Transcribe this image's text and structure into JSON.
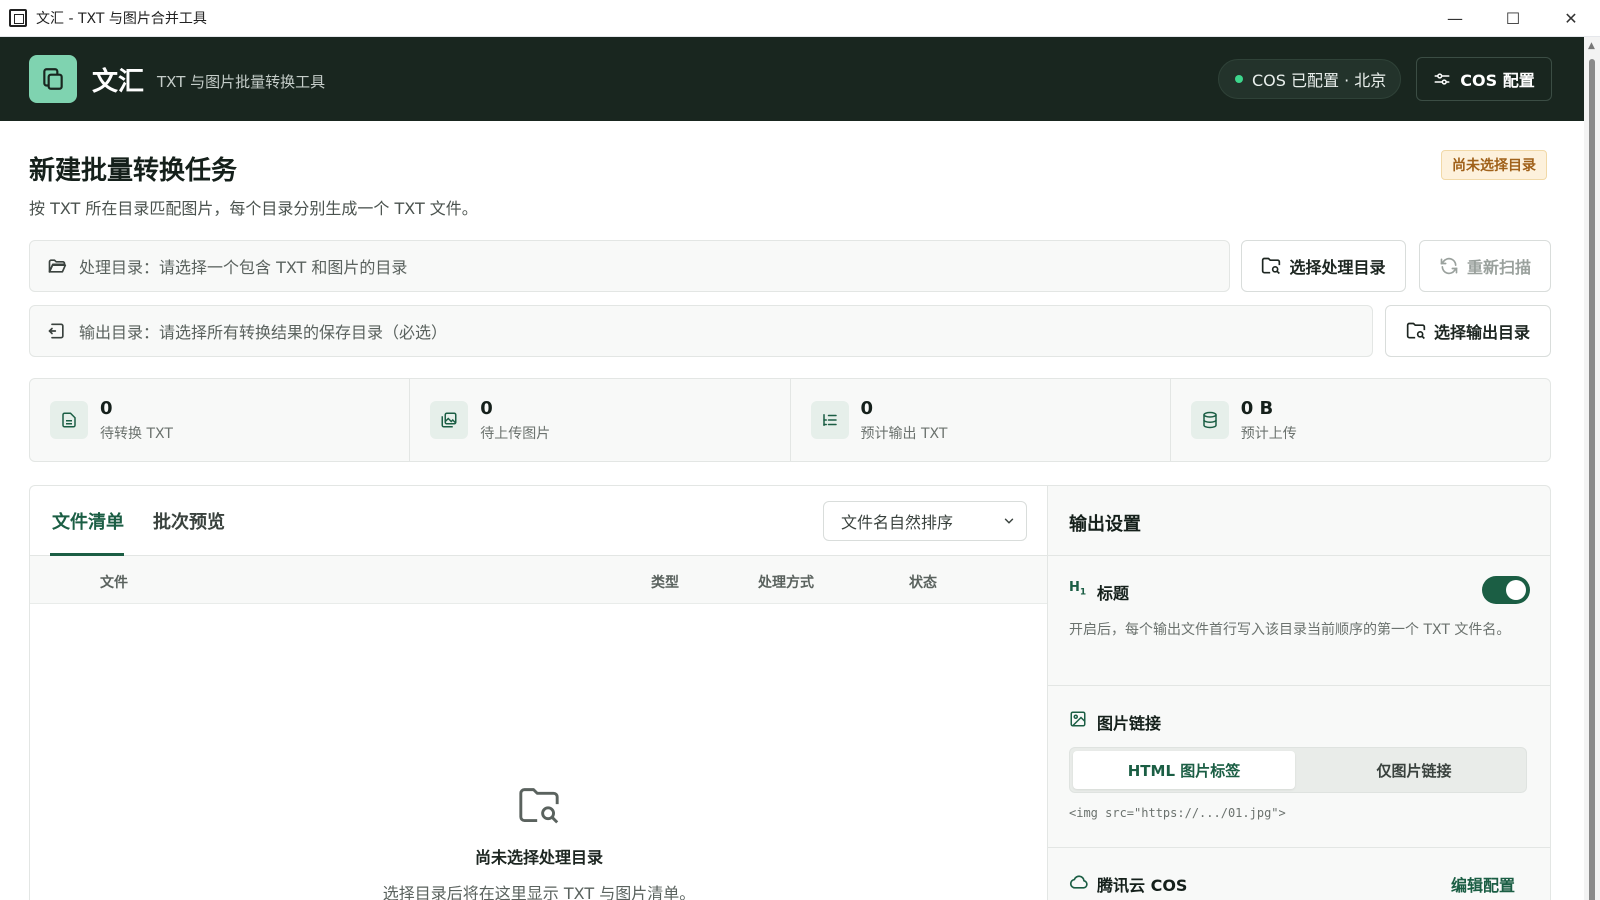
{
  "window": {
    "title": "文汇 - TXT 与图片合并工具",
    "minimize_glyph": "—",
    "maximize_glyph": "☐",
    "close_glyph": "✕"
  },
  "header": {
    "brand": "文汇",
    "subtitle": "TXT 与图片批量转换工具",
    "cos_status": "COS 已配置 · 北京",
    "cos_button": "COS 配置"
  },
  "task": {
    "title": "新建批量转换任务",
    "description": "按 TXT 所在目录匹配图片，每个目录分别生成一个 TXT 文件。",
    "badge": "尚未选择目录"
  },
  "process_dir": {
    "text": "处理目录：请选择一个包含 TXT 和图片的目录",
    "select_button": "选择处理目录",
    "rescan_button": "重新扫描"
  },
  "output_dir": {
    "text": "输出目录：请选择所有转换结果的保存目录（必选）",
    "select_button": "选择输出目录"
  },
  "stats": [
    {
      "value": "0",
      "label": "待转换 TXT",
      "icon": "file-text-icon"
    },
    {
      "value": "0",
      "label": "待上传图片",
      "icon": "images-icon"
    },
    {
      "value": "0",
      "label": "预计输出 TXT",
      "icon": "list-tree-icon"
    },
    {
      "value": "0 B",
      "label": "预计上传",
      "icon": "database-icon"
    }
  ],
  "files": {
    "tabs": [
      "文件清单",
      "批次预览"
    ],
    "active_tab": 0,
    "sort_option": "文件名自然排序",
    "columns": [
      "文件",
      "类型",
      "处理方式",
      "状态"
    ],
    "empty_title": "尚未选择处理目录",
    "empty_desc": "选择目录后将在这里显示 TXT 与图片清单。"
  },
  "settings": {
    "title": "输出设置",
    "heading_section": {
      "title": "标题",
      "enabled": true,
      "description": "开启后，每个输出文件首行写入该目录当前顺序的第一个 TXT 文件名。"
    },
    "image_link_section": {
      "title": "图片链接",
      "options": [
        "HTML 图片标签",
        "仅图片链接"
      ],
      "selected": 0,
      "sample": "<img src=\"https://.../01.jpg\">"
    },
    "cos_section": {
      "title": "腾讯云 COS",
      "edit_link": "编辑配置"
    }
  },
  "colors": {
    "header_bg": "#19261f",
    "accent": "#1b5e44",
    "logo_bg": "#7fd3b0",
    "status_dot": "#3dd68c",
    "badge_text": "#a0611a"
  }
}
